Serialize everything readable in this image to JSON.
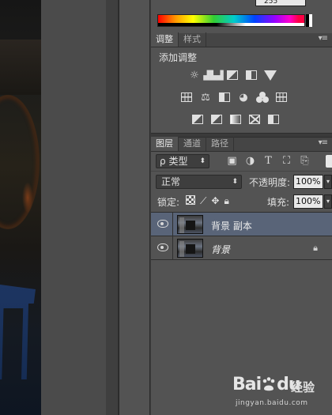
{
  "color_panel": {
    "rgb_value": "255",
    "colors": {
      "spectrum_start": "#ff0000",
      "black": "#000000",
      "white": "#ffffff"
    }
  },
  "adjustments_panel": {
    "tabs": [
      {
        "label": "调整",
        "active": true
      },
      {
        "label": "样式",
        "active": false
      }
    ],
    "title": "添加调整",
    "row1_icons": [
      "brightness-icon",
      "levels-icon",
      "curves-icon",
      "exposure-icon",
      "vibrance-icon"
    ],
    "row2_icons": [
      "hue-saturation-icon",
      "color-balance-icon",
      "black-white-icon",
      "photo-filter-icon",
      "channel-mixer-icon",
      "color-lookup-icon"
    ],
    "row3_icons": [
      "invert-icon",
      "posterize-icon",
      "threshold-icon",
      "gradient-map-icon",
      "selective-color-icon"
    ]
  },
  "layers_panel": {
    "tabs": [
      {
        "label": "图层",
        "active": true
      },
      {
        "label": "通道",
        "active": false
      },
      {
        "label": "路径",
        "active": false
      }
    ],
    "filter": {
      "search_glyph": "ρ",
      "kind_label": "类型"
    },
    "filter_icons": [
      "image-filter-icon",
      "adjustment-filter-icon",
      "type-filter-icon",
      "shape-filter-icon",
      "smart-object-filter-icon"
    ],
    "blend_mode": "正常",
    "opacity_label": "不透明度:",
    "opacity_value": "100%",
    "lock_label": "锁定:",
    "fill_label": "填充:",
    "fill_value": "100%",
    "layers": [
      {
        "name": "背景 副本",
        "selected": true,
        "italic": false,
        "locked": false,
        "visible": true
      },
      {
        "name": "背景",
        "selected": false,
        "italic": true,
        "locked": true,
        "visible": true
      }
    ],
    "selected_color": "#596478"
  },
  "watermark": {
    "brand": "Bai",
    "brand_suffix": "du",
    "chinese": "经验",
    "url": "jingyan.baidu.com"
  }
}
